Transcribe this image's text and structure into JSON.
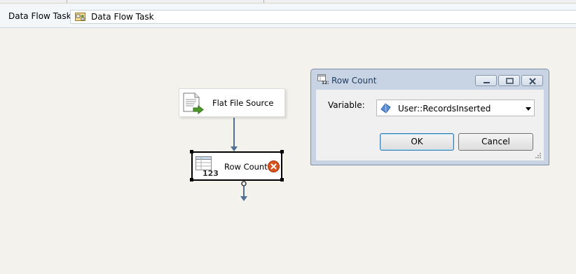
{
  "task_bar": {
    "label": "Data Flow Task:",
    "selected_task": "Data Flow Task",
    "selected_task_icon": "data-flow-task-icon"
  },
  "canvas": {
    "components": [
      {
        "name": "Flat File Source",
        "icon": "flat-file-source-icon"
      },
      {
        "name": "Row Count",
        "icon": "row-count-icon",
        "icon_text": "123",
        "status_icon": "error-icon"
      }
    ]
  },
  "dialog": {
    "title": "Row Count",
    "title_icon": "row-count-icon",
    "caption_buttons": [
      "minimize",
      "restore",
      "close"
    ],
    "variable_label": "Variable:",
    "variable_value": "User::RecordsInserted",
    "variable_icon": "variable-icon",
    "ok_label": "OK",
    "cancel_label": "Cancel"
  },
  "colors": {
    "canvas_background": "#f4f2ec",
    "connector": "#4f6f94",
    "error": "#d9531e",
    "dialog_frame": "#c8d4e4"
  }
}
